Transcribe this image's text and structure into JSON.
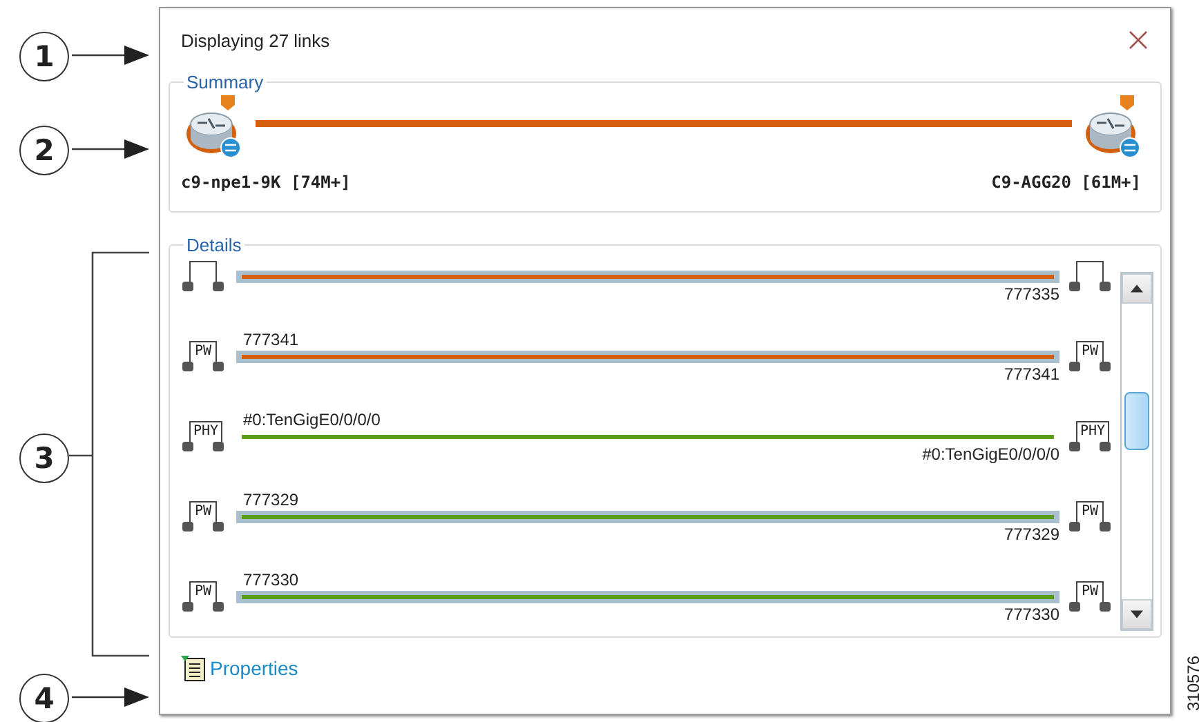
{
  "callouts": [
    {
      "number": "1",
      "kind": "arrow"
    },
    {
      "number": "2",
      "kind": "arrow"
    },
    {
      "number": "3",
      "kind": "bracket"
    },
    {
      "number": "4",
      "kind": "arrow"
    }
  ],
  "window": {
    "title": "Displaying 27 links"
  },
  "summary": {
    "legend": "Summary",
    "endpoints": [
      {
        "name": "c9-npe1-9K [74M+]"
      },
      {
        "name": "C9-AGG20 [61M+]"
      }
    ]
  },
  "details": {
    "legend": "Details",
    "links": [
      {
        "tunnel": true,
        "color": "#d35f0f",
        "bottom_label": "777335"
      },
      {
        "tunnel": true,
        "color": "#d35f0f",
        "left_tag": "PW",
        "right_tag": "PW",
        "top_label": "777341",
        "bottom_label": "777341"
      },
      {
        "tunnel": false,
        "color": "#5a9e1a",
        "left_tag": "PHY",
        "right_tag": "PHY",
        "top_label": "#0:TenGigE0/0/0/0",
        "bottom_label": "#0:TenGigE0/0/0/0"
      },
      {
        "tunnel": true,
        "color": "#5a9e1a",
        "left_tag": "PW",
        "right_tag": "PW",
        "top_label": "777329",
        "bottom_label": "777329"
      },
      {
        "tunnel": true,
        "color": "#5a9e1a",
        "left_tag": "PW",
        "right_tag": "PW",
        "top_label": "777330",
        "bottom_label": "777330"
      }
    ]
  },
  "footer": {
    "link": "Properties"
  },
  "figure_id": "310576"
}
